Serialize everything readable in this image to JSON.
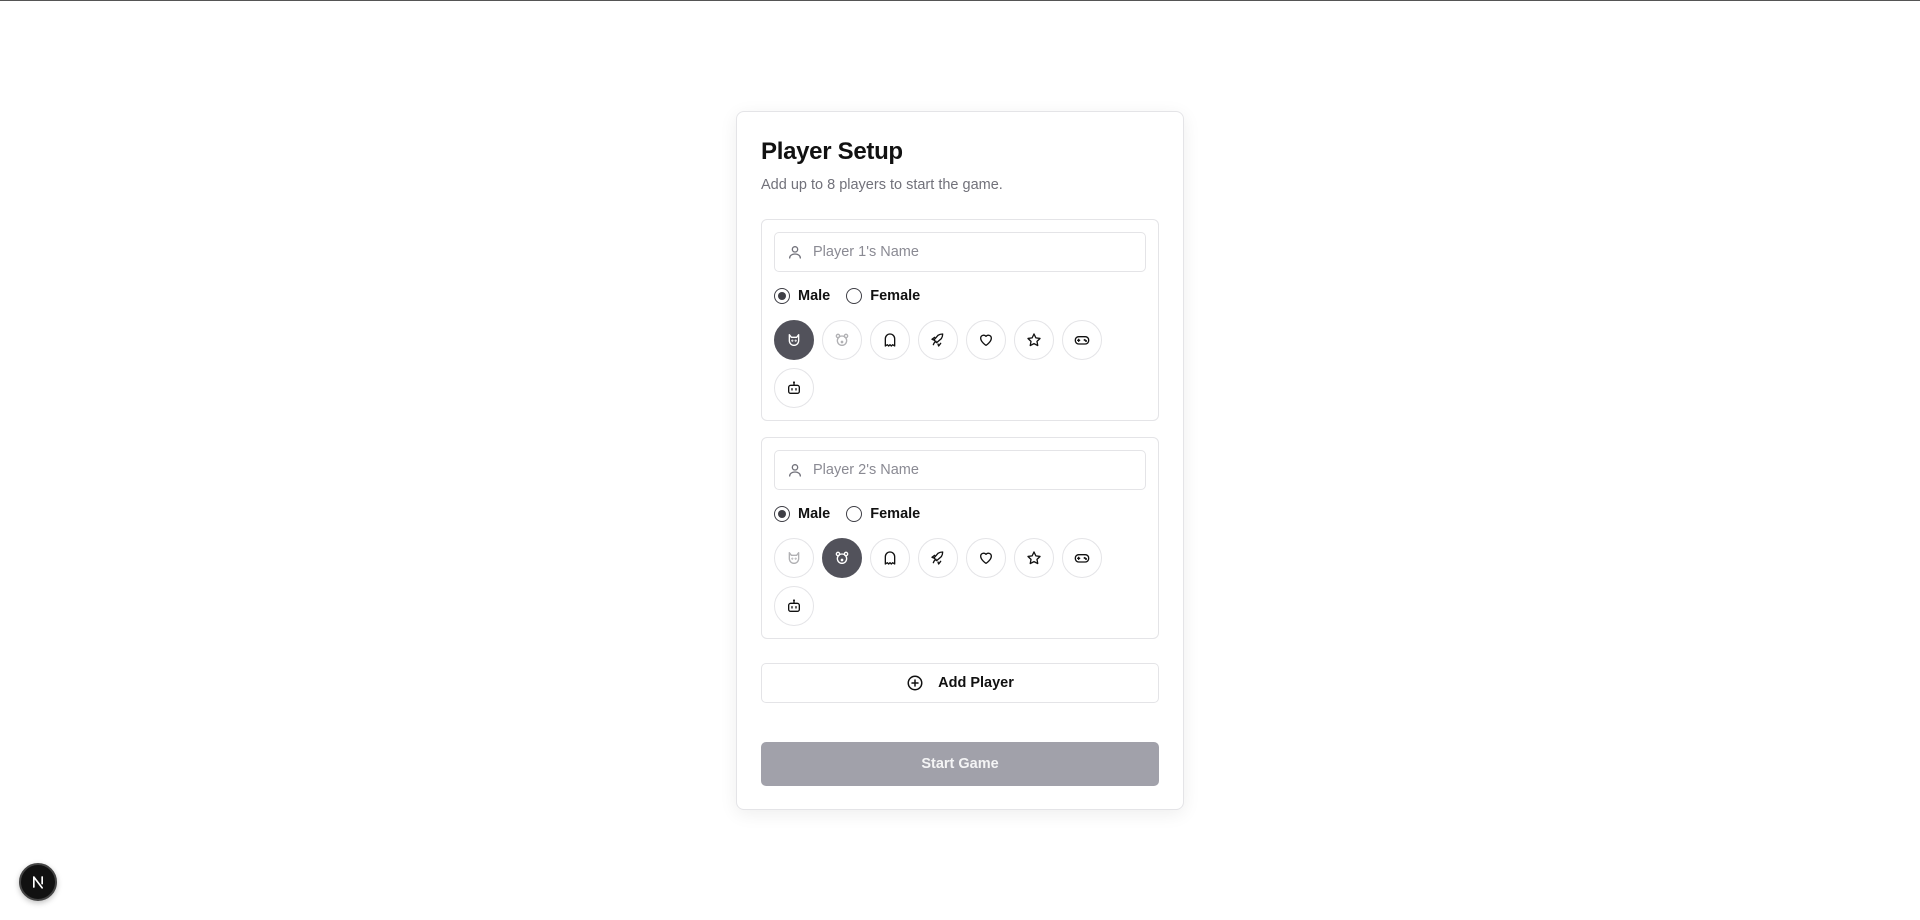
{
  "page": {
    "title": "Player Setup",
    "subtitle": "Add up to 8 players to start the game."
  },
  "gender_options": [
    "Male",
    "Female"
  ],
  "icon_set": [
    "cat-icon",
    "bear-icon",
    "ghost-icon",
    "rocket-icon",
    "heart-icon",
    "star-icon",
    "gamepad-icon",
    "robot-icon"
  ],
  "players": [
    {
      "name_value": "",
      "name_placeholder": "Player 1's Name",
      "gender_selected": "Male",
      "selected_icon": "cat-icon",
      "faded_icon": "bear-icon"
    },
    {
      "name_value": "",
      "name_placeholder": "Player 2's Name",
      "gender_selected": "Male",
      "selected_icon": "bear-icon",
      "faded_icon": "cat-icon"
    }
  ],
  "actions": {
    "add_player_label": "Add Player",
    "start_game_label": "Start Game",
    "start_game_disabled": true
  },
  "colors": {
    "selected_icon_bg": "#52525b",
    "start_disabled_bg": "#a1a1aa",
    "border": "#e4e4e7",
    "muted_text": "#71717a"
  },
  "dev_badge": {
    "letter": "N"
  }
}
